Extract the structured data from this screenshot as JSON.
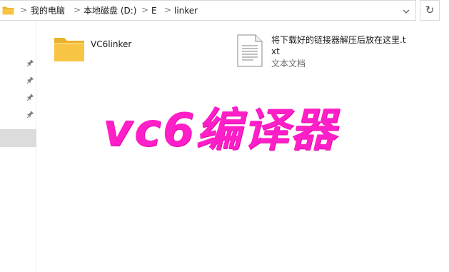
{
  "address_bar": {
    "breadcrumbs": [
      "我的电脑",
      "本地磁盘 (D:)",
      "E",
      "linker"
    ],
    "separator": ">"
  },
  "files": [
    {
      "name": "VC6linker",
      "kind": "folder"
    },
    {
      "name": "将下载好的链接器解压后放在这里.txt",
      "kind": "text-file",
      "type_label": "文本文档"
    }
  ],
  "overlay_text": "vc6编译器",
  "colors": {
    "overlay": "#ff1fc8",
    "folder_yellow": "#f7c443",
    "selection": "#dcdcdc"
  },
  "icons": [
    "folder-icon",
    "pin-icon",
    "chevron-down-icon",
    "refresh-icon",
    "text-file-icon"
  ]
}
